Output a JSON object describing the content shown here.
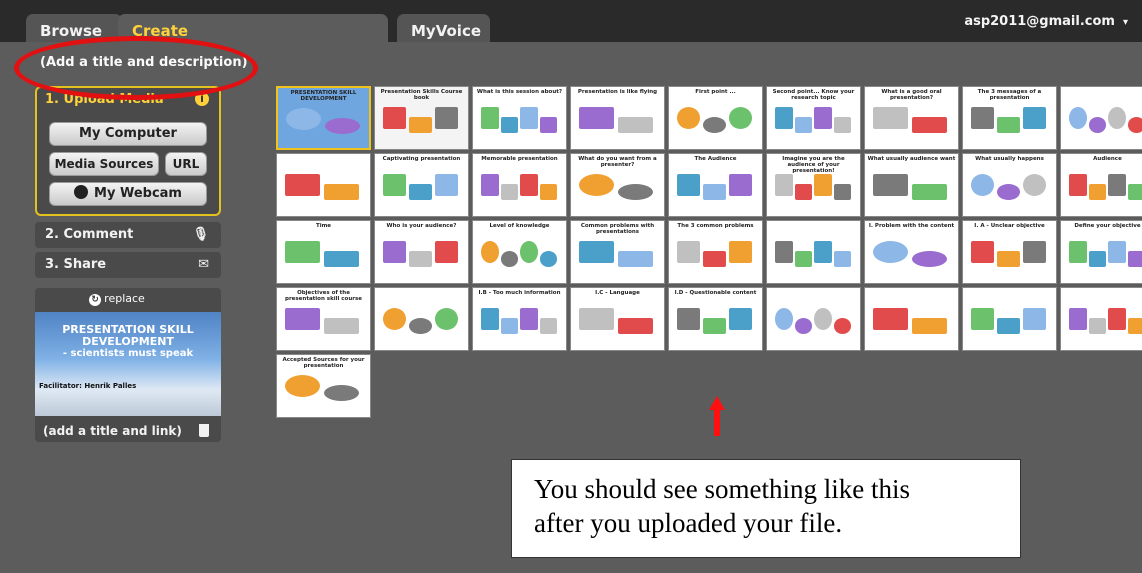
{
  "tabs": {
    "browse": "Browse",
    "create": "Create",
    "myvoice": "MyVoice"
  },
  "account": {
    "email": "asp2011@gmail.com",
    "caret": "▾"
  },
  "title_desc": "(Add a title and description)",
  "upload": {
    "heading": "1. Upload Media",
    "my_computer": "My Computer",
    "media_sources": "Media Sources",
    "url": "URL",
    "webcam": "My Webcam"
  },
  "steps": {
    "comment": "2. Comment",
    "share": "3. Share"
  },
  "thumb": {
    "replace": "replace",
    "title": "PRESENTATION SKILL DEVELOPMENT",
    "subtitle": "- scientists must speak",
    "facilitator": "Facilitator: Henrik Palles",
    "add_link": "(add a title and link)"
  },
  "slides": [
    {
      "title": "PRESENTATION SKILL DEVELOPMENT",
      "bg": "#6fa6e0"
    },
    {
      "title": "Presentation Skills Course book",
      "bg": "#f4f4f4"
    },
    {
      "title": "What is this session about?",
      "bg": "#ffffff"
    },
    {
      "title": "Presentation is like flying",
      "bg": "#ffffff"
    },
    {
      "title": "First point ...",
      "bg": "#ffffff"
    },
    {
      "title": "Second point... Know your research topic",
      "bg": "#ffffff"
    },
    {
      "title": "What is a good oral presentation?",
      "bg": "#ffffff"
    },
    {
      "title": "The 3 messages of a presentation",
      "bg": "#ffffff"
    },
    {
      "title": "",
      "bg": "#ffffff"
    },
    {
      "title": "",
      "bg": "#ffffff"
    },
    {
      "title": "Captivating presentation",
      "bg": "#ffffff"
    },
    {
      "title": "Memorable presentation",
      "bg": "#ffffff"
    },
    {
      "title": "What do you want from a presenter?",
      "bg": "#ffffff"
    },
    {
      "title": "The Audience",
      "bg": "#ffffff"
    },
    {
      "title": "Imagine you are the audience of your presentation!",
      "bg": "#ffffff"
    },
    {
      "title": "What usually audience want",
      "bg": "#ffffff"
    },
    {
      "title": "What usually happens",
      "bg": "#ffffff"
    },
    {
      "title": "Audience",
      "bg": "#ffffff"
    },
    {
      "title": "Time",
      "bg": "#ffffff"
    },
    {
      "title": "Who is your audience?",
      "bg": "#ffffff"
    },
    {
      "title": "Level of knowledge",
      "bg": "#ffffff"
    },
    {
      "title": "Common problems with presentations",
      "bg": "#ffffff"
    },
    {
      "title": "The 3 common problems",
      "bg": "#ffffff"
    },
    {
      "title": "",
      "bg": "#ffffff"
    },
    {
      "title": "I. Problem with the content",
      "bg": "#ffffff"
    },
    {
      "title": "I. A - Unclear objective",
      "bg": "#ffffff"
    },
    {
      "title": "Define your objective",
      "bg": "#ffffff"
    },
    {
      "title": "Objectives of the presentation skill course",
      "bg": "#ffffff"
    },
    {
      "title": "",
      "bg": "#ffffff"
    },
    {
      "title": "I.B - Too much information",
      "bg": "#ffffff"
    },
    {
      "title": "I.C - Language",
      "bg": "#ffffff"
    },
    {
      "title": "I.D - Questionable content",
      "bg": "#ffffff"
    },
    {
      "title": "",
      "bg": "#ffffff"
    },
    {
      "title": "",
      "bg": "#ffffff"
    },
    {
      "title": "",
      "bg": "#ffffff"
    },
    {
      "title": "",
      "bg": "#ffffff"
    },
    {
      "title": "Accepted Sources for your presentation",
      "bg": "#ffffff"
    }
  ],
  "callout": {
    "line1": "You should see something like this",
    "line2": "after you uploaded your file."
  }
}
